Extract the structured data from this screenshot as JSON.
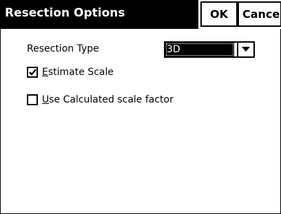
{
  "window": {
    "title": "Resection Options",
    "ok_label": "OK",
    "cancel_label": "Cancel"
  },
  "form": {
    "resection_type_label": "Resection Type",
    "resection_type_value": "3D",
    "estimate_scale": {
      "accel": "E",
      "rest": "stimate Scale",
      "checked": true
    },
    "use_calculated": {
      "accel": "U",
      "rest": "se Calculated scale factor",
      "checked": false
    }
  },
  "icons": {
    "dropdown": "chevron-down-icon",
    "check": "checkmark-icon"
  },
  "colors": {
    "title_bg": "#000000",
    "title_fg": "#ffffff",
    "background": "#ffffff"
  }
}
